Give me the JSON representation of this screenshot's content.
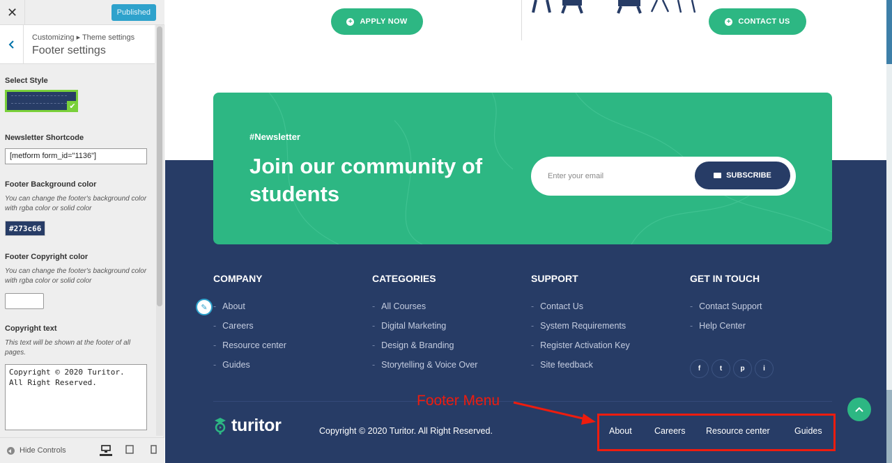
{
  "customizer": {
    "close_glyph": "✕",
    "published_label": "Published",
    "breadcrumb": "Customizing ▸ Theme settings",
    "section_title": "Footer settings",
    "select_style_label": "Select Style",
    "newsletter_label": "Newsletter Shortcode",
    "newsletter_value": "[metform form_id=\"1136\"]",
    "bg_color_label": "Footer Background color",
    "bg_color_desc": "You can change the footer's background color with rgba color or solid color",
    "bg_color_value": "#273c66",
    "copyright_color_label": "Footer Copyright color",
    "copyright_color_desc": "You can change the footer's background color with rgba color or solid color",
    "copyright_text_label": "Copyright text",
    "copyright_text_desc": "This text will be shown at the footer of all pages.",
    "copyright_text_value": "Copyright © 2020 Turitor.\nAll Right Reserved.",
    "hide_controls_label": "Hide Controls"
  },
  "preview": {
    "apply_button": "APPLY NOW",
    "contact_button": "CONTACT US",
    "newsletter": {
      "tag": "#Newsletter",
      "title": "Join our community of students",
      "email_placeholder": "Enter  your email",
      "subscribe_label": "SUBSCRIBE"
    },
    "columns": [
      {
        "heading": "COMPANY",
        "items": [
          "About",
          "Careers",
          "Resource center",
          "Guides"
        ]
      },
      {
        "heading": "CATEGORIES",
        "items": [
          "All Courses",
          "Digital Marketing",
          "Design & Branding",
          "Storytelling & Voice Over"
        ]
      },
      {
        "heading": "SUPPORT",
        "items": [
          "Contact Us",
          "System Requirements",
          "Register Activation Key",
          "Site feedback"
        ]
      },
      {
        "heading": "GET IN TOUCH",
        "items": [
          "Contact Support",
          "Help Center"
        ]
      }
    ],
    "social": [
      "f",
      "t",
      "p",
      "i"
    ],
    "logo_text": "turitor",
    "copyright": "Copyright © 2020 Turitor. All Right Reserved.",
    "footer_menu": [
      "About",
      "Careers",
      "Resource center",
      "Guides"
    ],
    "annotation_label": "Footer Menu"
  },
  "colors": {
    "accent_green": "#2db783",
    "footer_navy": "#273c66",
    "annotation_red": "#ee1c0e",
    "wp_blue": "#2ea2cc"
  }
}
